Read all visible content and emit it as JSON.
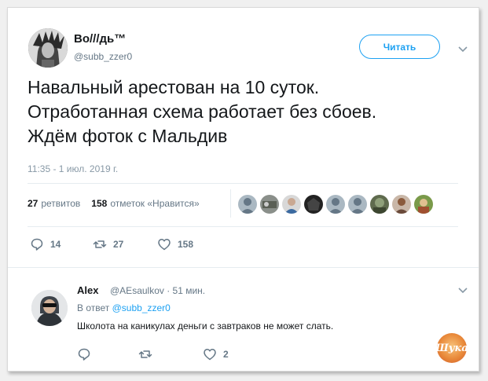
{
  "tweet": {
    "author_name": "Во///дь™",
    "author_handle": "@subb_zzer0",
    "follow_label": "Читать",
    "text": "Навальный арестован на 10 суток.\nОтработанная схема работает без сбоев.\nЖдём фоток с Мальдив",
    "timestamp": "11:35 - 1 июл. 2019 г.",
    "retweets_count": "27",
    "retweets_label": "ретвитов",
    "likes_count": "158",
    "likes_label": "отметок «Нравится»",
    "actions": {
      "reply_count": "14",
      "retweet_count": "27",
      "like_count": "158"
    }
  },
  "reply": {
    "author_name": "Alex",
    "meta": "@AEsaulkov · 51 мин.",
    "in_reply_prefix": "В ответ",
    "in_reply_handle": "@subb_zzer0",
    "text": "Школота на каникулах деньги с завтраков не может слать.",
    "actions": {
      "reply_count": "",
      "retweet_count": "",
      "like_count": "2"
    }
  },
  "watermark": {
    "text": "Шука"
  },
  "colors": {
    "accent": "#1da1f2",
    "muted": "#657786",
    "text": "#14171a",
    "like": "#e0245e"
  }
}
